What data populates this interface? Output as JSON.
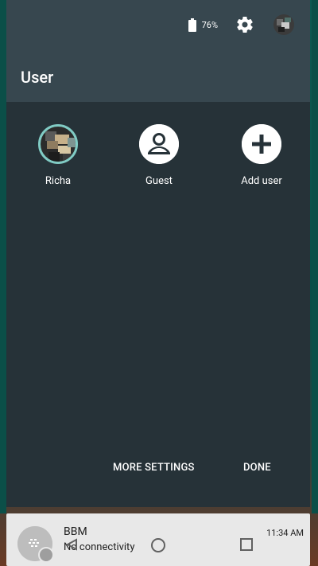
{
  "status": {
    "battery_percent": "76%",
    "battery_level": 0.76
  },
  "header": {
    "title": "User"
  },
  "users": [
    {
      "name": "Richa",
      "icon": "user-photo-avatar"
    },
    {
      "name": "Guest",
      "icon": "account-circle-icon"
    },
    {
      "name": "Add user",
      "icon": "add-circle-icon"
    }
  ],
  "actions": {
    "more_settings": "MORE SETTINGS",
    "done": "DONE"
  },
  "notification": {
    "app": "BBM",
    "text": "No connectivity",
    "time": "11:34 AM",
    "icon": "bbm-icon"
  },
  "nav": {
    "back": "back-icon",
    "home": "home-icon",
    "recent": "recents-icon"
  },
  "colors": {
    "panel_bg": "#263238",
    "header_bg": "#37474f",
    "accent": "#80cbc4",
    "wallpaper": "#0b4f48"
  }
}
